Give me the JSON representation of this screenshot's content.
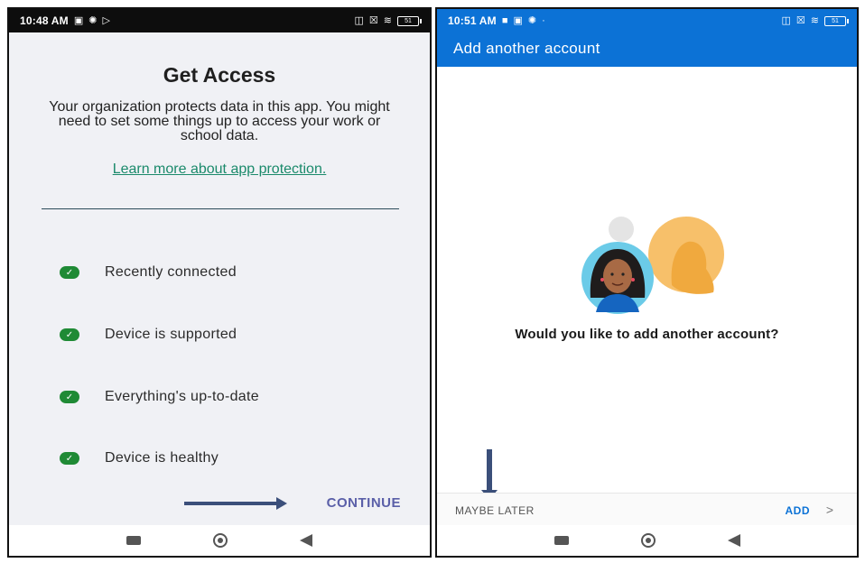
{
  "left_screen": {
    "status_bar": {
      "time": "10:48 AM",
      "battery": "51",
      "icons_left": [
        "image-icon",
        "gear-icon",
        "play-icon"
      ],
      "icons_right": [
        "lock-icon",
        "sim-icon",
        "wifi-icon",
        "battery-icon"
      ]
    },
    "title": "Get Access",
    "description": "Your organization protects data in this app. You might need to set some things up to access your work or school data.",
    "link": "Learn more about app protection.",
    "checks": [
      {
        "label": "Recently connected"
      },
      {
        "label": "Device is supported"
      },
      {
        "label": "Everything's up-to-date"
      },
      {
        "label": "Device is healthy"
      }
    ],
    "continue_label": "CONTINUE"
  },
  "right_screen": {
    "status_bar": {
      "time": "10:51 AM",
      "battery": "51",
      "icons_left": [
        "teams-icon",
        "image-icon",
        "gear-icon",
        "dot-icon"
      ],
      "icons_right": [
        "lock-icon",
        "sim-icon",
        "wifi-icon",
        "battery-icon"
      ]
    },
    "appbar_title": "Add another account",
    "question": "Would you like to add another account?",
    "maybe_later": "MAYBE LATER",
    "add": "ADD",
    "chevron": ">"
  },
  "colors": {
    "accent_blue": "#0c72d6",
    "check_green": "#1f8a35",
    "link_teal": "#1b8a6b",
    "continue_purple": "#5a5fa8",
    "arrow": "#3b4f7a"
  }
}
